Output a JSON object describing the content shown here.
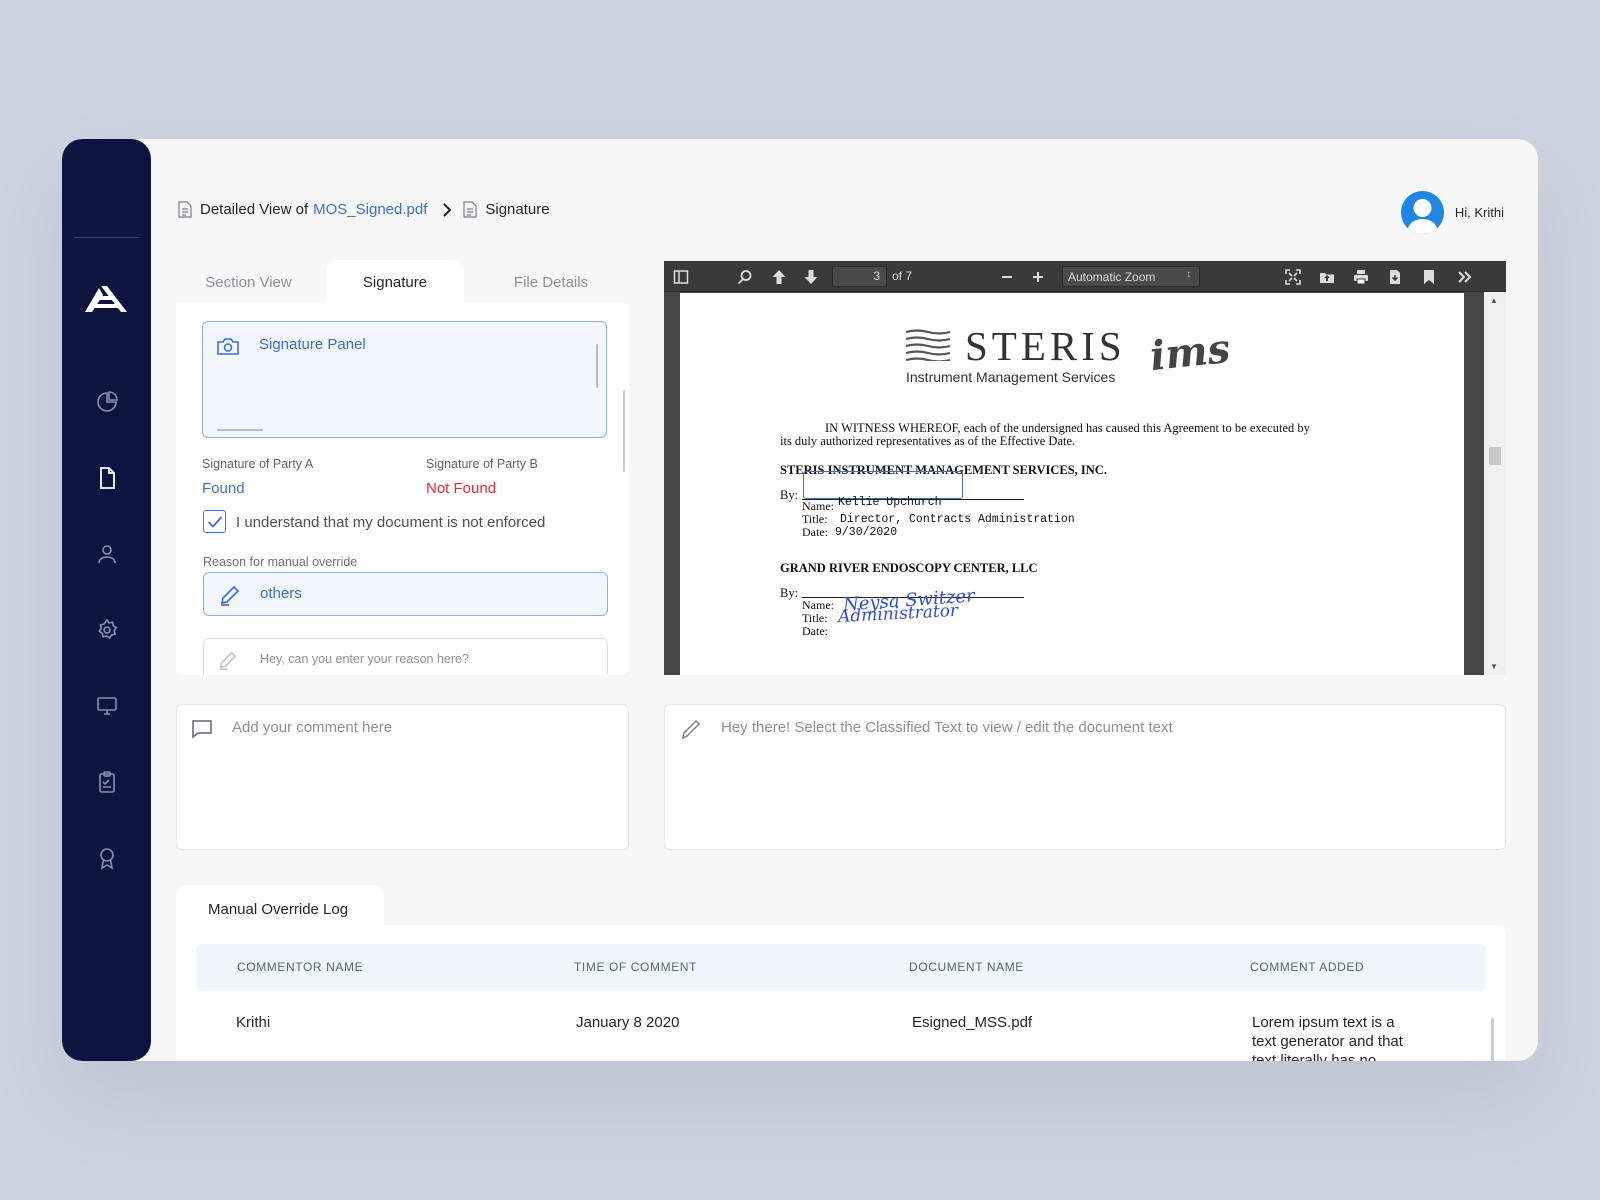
{
  "breadcrumb": {
    "prefix": "Detailed View of",
    "file_link": "MOS_Signed.pdf",
    "current": "Signature"
  },
  "user": {
    "greeting": "Hi, Krithi"
  },
  "sidebar": {
    "items": [
      {
        "name": "analytics",
        "icon": "pie-chart-icon"
      },
      {
        "name": "documents",
        "icon": "document-icon",
        "active": true
      },
      {
        "name": "users",
        "icon": "user-icon"
      },
      {
        "name": "settings",
        "icon": "gear-icon"
      },
      {
        "name": "monitor",
        "icon": "monitor-icon"
      },
      {
        "name": "tasks",
        "icon": "clipboard-icon"
      },
      {
        "name": "awards",
        "icon": "award-icon"
      }
    ]
  },
  "tabs": [
    {
      "label": "Section View"
    },
    {
      "label": "Signature",
      "active": true
    },
    {
      "label": "File Details"
    }
  ],
  "signature": {
    "panel_title": "Signature Panel",
    "party_a_label": "Signature of Party A",
    "party_a_value": "Found",
    "party_b_label": "Signature of Party B",
    "party_b_value": "Not Found",
    "checkbox_label": "I understand that my document is not enforced",
    "checkbox_checked": true,
    "reason_label": "Reason for manual override",
    "reason_value": "others",
    "reason_placeholder": "Hey, can you enter your reason here?"
  },
  "viewer": {
    "page_current": "3",
    "page_total": "of 7",
    "zoom": "Automatic Zoom",
    "document": {
      "logo_text": "STERIS",
      "logo_sub": "Instrument Management Services",
      "logo_script": "ims",
      "witness_line1": "IN WITNESS WHEREOF, each of the undersigned has caused this Agreement to be executed by",
      "witness_line2": "its duly authorized representatives as of the Effective Date.",
      "party1_heading": "STERIS INSTRUMENT MANAGEMENT SERVICES, INC.",
      "party1_by": "By:",
      "party1_name_label": "Name:",
      "party1_name": "Kellie Upchurch",
      "party1_title_label": "Title:",
      "party1_title": "Director, Contracts Administration",
      "party1_date_label": "Date:",
      "party1_date": "9/30/2020",
      "party2_heading": "GRAND RIVER ENDOSCOPY CENTER, LLC",
      "party2_by": "By:",
      "party2_name_label": "Name:",
      "party2_name": "Neysa Switzer",
      "party2_title_label": "Title:",
      "party2_title": "Administrator",
      "party2_date_label": "Date:"
    }
  },
  "comment": {
    "placeholder": "Add your comment here"
  },
  "editor": {
    "placeholder": "Hey there! Select the Classified Text to view / edit the document text"
  },
  "log": {
    "tab_label": "Manual Override Log",
    "columns": [
      "COMMENTOR NAME",
      "TIME OF COMMENT",
      "DOCUMENT NAME",
      "COMMENT ADDED"
    ],
    "rows": [
      {
        "commentor": "Krithi",
        "time": "January 8 2020",
        "document": "Esigned_MSS.pdf",
        "comment_lines": [
          "Lorem ipsum text is a",
          "text generator and that",
          "text literally has no"
        ]
      }
    ]
  },
  "colors": {
    "sidebar": "#0c1540",
    "accent": "#3b6fe0",
    "error": "#ef2b2b",
    "avatar": "#1e86e6",
    "signature_ink": "#2f4ed8"
  }
}
